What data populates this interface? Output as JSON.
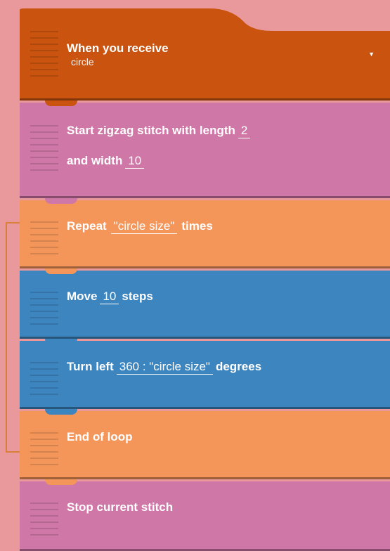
{
  "blocks": {
    "when_receive": {
      "label": "When you receive",
      "value": "circle"
    },
    "start_zigzag": {
      "label_1": "Start zigzag stitch with length",
      "length": "2",
      "label_2": "and width",
      "width": "10"
    },
    "repeat": {
      "label_1": "Repeat",
      "count": "\"circle size\"",
      "label_2": "times"
    },
    "move": {
      "label_1": "Move",
      "steps": "10",
      "label_2": "steps"
    },
    "turn_left": {
      "label_1": "Turn left",
      "degrees": "360 : \"circle size\"",
      "label_2": "degrees"
    },
    "end_loop": {
      "label": "End of loop"
    },
    "stop_stitch": {
      "label": "Stop current stitch"
    }
  },
  "colors": {
    "background": "#e9999b",
    "event": "#c9530f",
    "stitch": "#cf77a6",
    "control": "#f4965a",
    "motion": "#3d85bf"
  }
}
